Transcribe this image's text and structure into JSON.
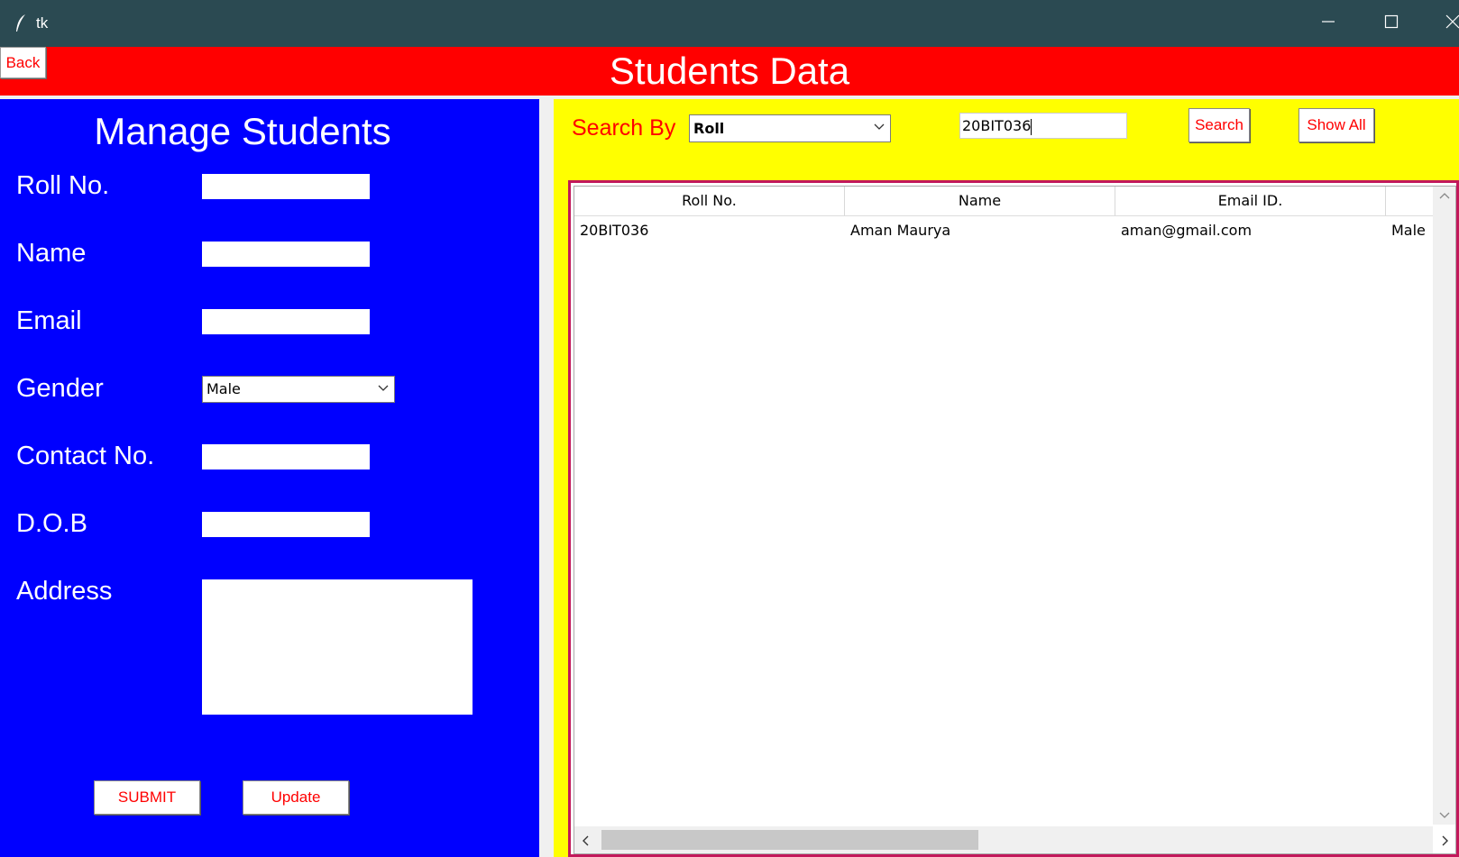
{
  "window": {
    "title": "tk"
  },
  "header": {
    "title": "Students Data",
    "back_label": "Back"
  },
  "manage": {
    "title": "Manage Students",
    "labels": {
      "roll": "Roll No.",
      "name": "Name",
      "email": "Email",
      "gender": "Gender",
      "contact": "Contact No.",
      "dob": "D.O.B",
      "address": "Address"
    },
    "values": {
      "roll": "",
      "name": "",
      "email": "",
      "gender": "Male",
      "contact": "",
      "dob": "",
      "address": ""
    },
    "submit_label": "SUBMIT",
    "update_label": "Update"
  },
  "search": {
    "label": "Search By",
    "by_value": "Roll",
    "query": "20BIT036",
    "search_label": "Search",
    "show_all_label": "Show All"
  },
  "table": {
    "columns": [
      "Roll No.",
      "Name",
      "Email ID.",
      ""
    ],
    "rows": [
      [
        "20BIT036",
        "Aman Maurya",
        "aman@gmail.com",
        "Male"
      ]
    ]
  },
  "colors": {
    "left_bg": "#0000ff",
    "right_bg": "#ffff00",
    "header_bg": "#ff0000",
    "titlebar_bg": "#2b4a52",
    "accent_text": "#ff0000"
  }
}
